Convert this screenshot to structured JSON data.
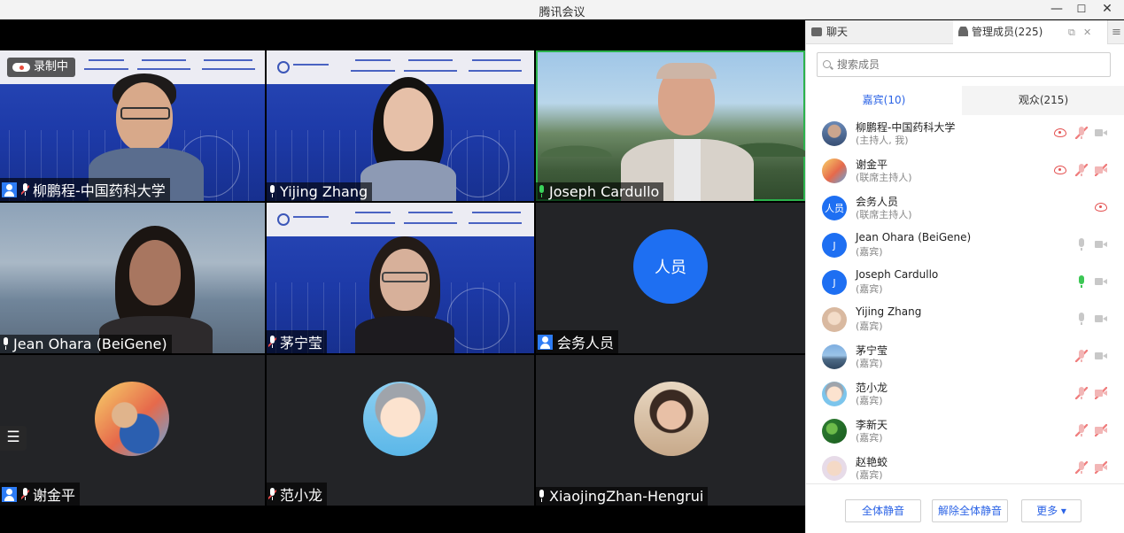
{
  "window": {
    "title": "腾讯会议",
    "minimize": "—",
    "maximize": "☐",
    "close": "✕"
  },
  "recording": {
    "label": "录制中"
  },
  "tiles": [
    {
      "name": "柳鹏程-中国药科大学",
      "host": true,
      "mic": "muted-partial"
    },
    {
      "name": "Yijing Zhang",
      "host": false,
      "mic": "on"
    },
    {
      "name": "Joseph Cardullo",
      "host": false,
      "mic": "speaking"
    },
    {
      "name": "Jean Ohara (BeiGene)",
      "host": false,
      "mic": "on"
    },
    {
      "name": "茅宁莹",
      "host": false,
      "mic": "muted-partial"
    },
    {
      "name": "会务人员",
      "host": true,
      "mic": "none",
      "avatar_text": "人员"
    },
    {
      "name": "谢金平",
      "host": true,
      "mic": "muted-partial"
    },
    {
      "name": "范小龙",
      "host": false,
      "mic": "muted-partial"
    },
    {
      "name": "XiaojingZhan-Hengrui",
      "host": false,
      "mic": "on"
    }
  ],
  "list_toggle": "☰",
  "panel": {
    "tab_chat": "聊天",
    "tab_members": "管理成员(225)",
    "search_placeholder": "搜索成员",
    "group_guests": "嘉宾(10)",
    "group_audience": "观众(215)",
    "members": [
      {
        "name": "柳鹏程-中国药科大学",
        "role": "(主持人, 我)",
        "avatar": "photo",
        "sharing": true,
        "mic": "off",
        "cam": "on"
      },
      {
        "name": "谢金平",
        "role": "(联席主持人)",
        "avatar": "photo",
        "sharing": true,
        "mic": "off",
        "cam": "off"
      },
      {
        "name": "会务人员",
        "role": "(联席主持人)",
        "avatar": "人员",
        "sharing": true,
        "mic": "none",
        "cam": "none"
      },
      {
        "name": "Jean Ohara (BeiGene)",
        "role": "(嘉宾)",
        "avatar": "J",
        "sharing": false,
        "mic": "idle",
        "cam": "on"
      },
      {
        "name": "Joseph Cardullo",
        "role": "(嘉宾)",
        "avatar": "J",
        "sharing": false,
        "mic": "on",
        "cam": "on"
      },
      {
        "name": "Yijing Zhang",
        "role": "(嘉宾)",
        "avatar": "photo",
        "sharing": false,
        "mic": "idle",
        "cam": "on"
      },
      {
        "name": "茅宁莹",
        "role": "(嘉宾)",
        "avatar": "photo",
        "sharing": false,
        "mic": "off",
        "cam": "on"
      },
      {
        "name": "范小龙",
        "role": "(嘉宾)",
        "avatar": "photo",
        "sharing": false,
        "mic": "off",
        "cam": "off"
      },
      {
        "name": "李新天",
        "role": "(嘉宾)",
        "avatar": "photo",
        "sharing": false,
        "mic": "off",
        "cam": "off"
      },
      {
        "name": "赵艳蛟",
        "role": "(嘉宾)",
        "avatar": "photo",
        "sharing": false,
        "mic": "off",
        "cam": "off"
      }
    ],
    "footer": {
      "mute_all": "全体静音",
      "unmute_all": "解除全体静音",
      "more": "更多 ▾"
    }
  },
  "colors": {
    "accent": "#2b63e6",
    "speaking": "#2bb24c",
    "host_badge": "#2d7cf6",
    "avatar_blue": "#1e6ff2"
  }
}
